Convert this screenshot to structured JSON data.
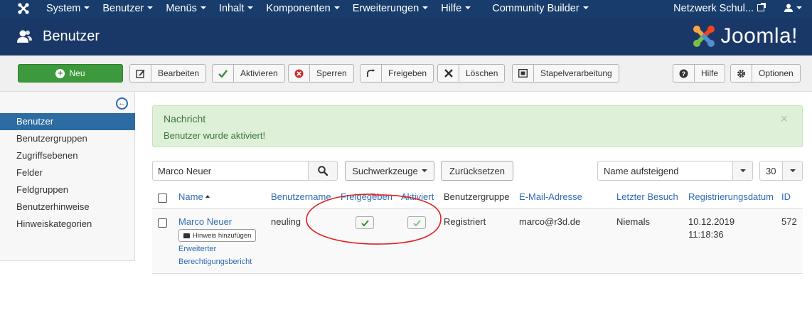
{
  "topnav": {
    "menu": [
      "System",
      "Benutzer",
      "Menüs",
      "Inhalt",
      "Komponenten",
      "Erweiterungen",
      "Hilfe",
      "Community Builder"
    ],
    "site_link": "Netzwerk Schul..."
  },
  "header": {
    "title": "Benutzer",
    "brand": "Joomla!"
  },
  "toolbar": {
    "new": "Neu",
    "edit": "Bearbeiten",
    "activate": "Aktivieren",
    "block": "Sperren",
    "unblock": "Freigeben",
    "delete": "Löschen",
    "batch": "Stapelverarbeitung",
    "help": "Hilfe",
    "options": "Optionen"
  },
  "sidebar": {
    "items": [
      {
        "label": "Benutzer",
        "active": true
      },
      {
        "label": "Benutzergruppen"
      },
      {
        "label": "Zugriffsebenen"
      },
      {
        "label": "Felder"
      },
      {
        "label": "Feldgruppen"
      },
      {
        "label": "Benutzerhinweise"
      },
      {
        "label": "Hinweiskategorien"
      }
    ]
  },
  "message": {
    "heading": "Nachricht",
    "text": "Benutzer wurde aktiviert!",
    "close": "×"
  },
  "filters": {
    "search_value": "Marco Neuer",
    "search_tools": "Suchwerkzeuge",
    "reset": "Zurücksetzen",
    "sort": "Name aufsteigend",
    "limit": "30"
  },
  "table": {
    "headers": [
      "Name",
      "Benutzername",
      "Freigegeben",
      "Aktiviert",
      "Benutzergruppe",
      "E-Mail-Adresse",
      "Letzter Besuch",
      "Registrierungsdatum",
      "ID"
    ],
    "rows": [
      {
        "name": "Marco Neuer",
        "note_button": "Hinweis hinzufügen",
        "link1": "Erweiterter",
        "link2": "Berechtigungsbericht",
        "username": "neuling",
        "group": "Registriert",
        "email": "marco@r3d.de",
        "last_visit": "Niemals",
        "reg_date": "10.12.2019",
        "reg_time": "11:18:36",
        "id": "572"
      }
    ]
  },
  "colors": {
    "topnav": "#183d6c",
    "header": "#1a3867",
    "active": "#2d6ca2",
    "success_bg": "#dff0d8",
    "annotation": "#e02020"
  }
}
